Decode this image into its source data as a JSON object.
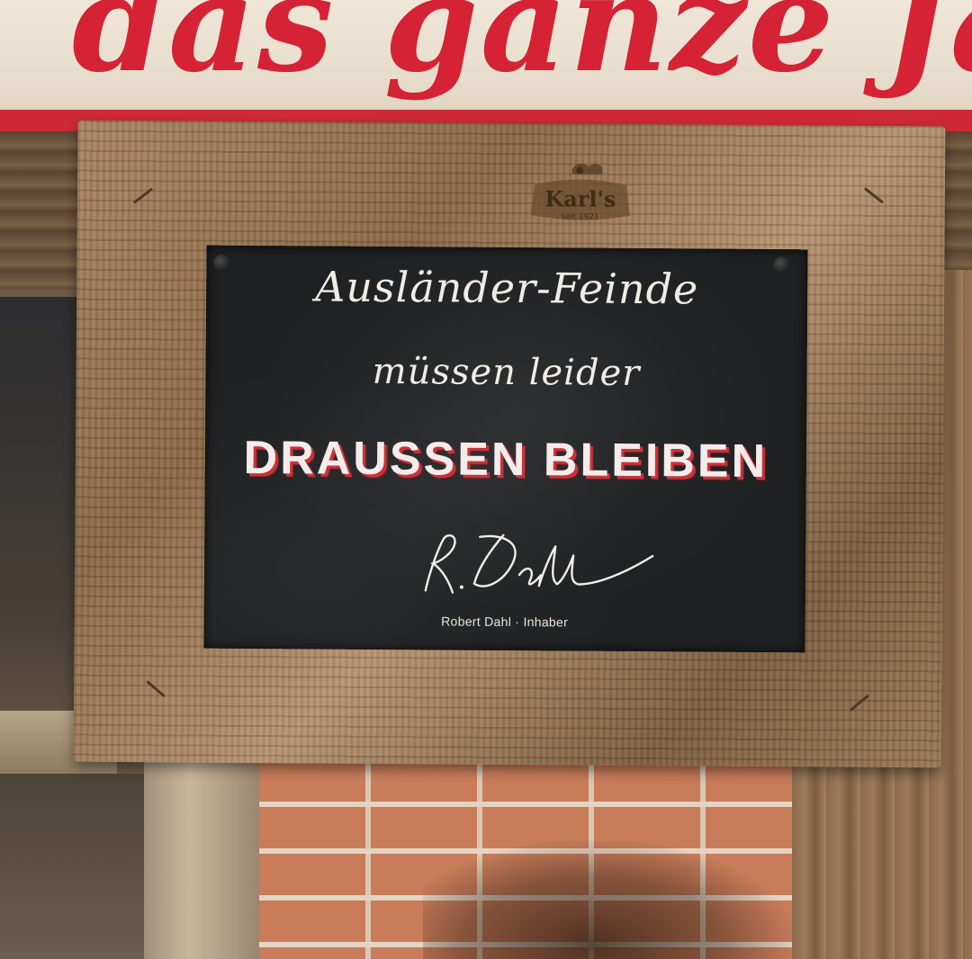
{
  "banner": {
    "text": "das ganze Jahr",
    "accent_color": "#d52235"
  },
  "frame": {
    "brand_logo_text": "Karl's",
    "brand_logo_sub": "seit 1921"
  },
  "sign": {
    "line1": "Ausländer-Feinde",
    "line2": "müssen leider",
    "line3": "DRAUSSEN BLEIBEN",
    "signature_text": "R. Dahl",
    "owner_caption": "Robert Dahl · Inhaber",
    "headline_shadow_color": "#c8343c"
  }
}
